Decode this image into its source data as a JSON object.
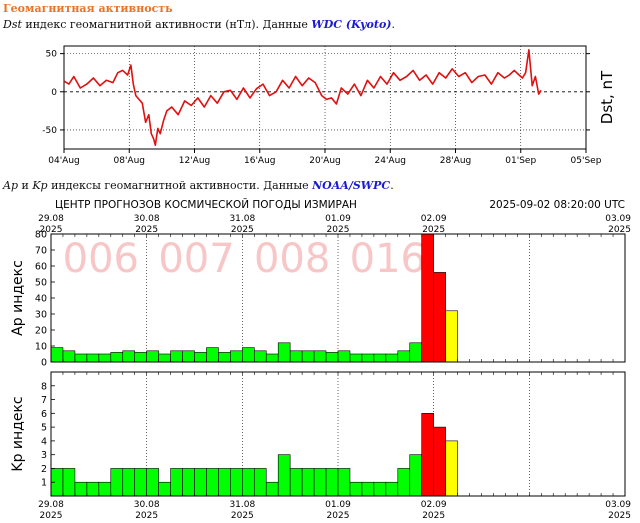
{
  "header": {
    "section_title": "Геомагнитная активность",
    "dst_caption_symbol": "Dst",
    "dst_caption_text": " индекс геомагнитной активности (нТл). Данные ",
    "dst_caption_source": "WDC (Kyoto)",
    "dst_caption_end": ".",
    "ap_caption_sym1": "Ap",
    "ap_caption_mid": " и ",
    "ap_caption_sym2": "Kp",
    "ap_caption_text": " индексы геомагнитной активности. Данные ",
    "ap_caption_source": "NOAA/SWPC",
    "ap_caption_end": "."
  },
  "chart_data": [
    {
      "type": "line",
      "ylabel": "Dst, nT",
      "ylim": [
        -75,
        60
      ],
      "y_ticks": [
        50,
        0,
        -50
      ],
      "x_ticks": [
        "04'Aug",
        "08'Aug",
        "12'Aug",
        "16'Aug",
        "20'Aug",
        "24'Aug",
        "28'Aug",
        "01'Sep",
        "05'Sep"
      ],
      "x_days": [
        0,
        4,
        8,
        12,
        16,
        20,
        24,
        28,
        32
      ],
      "grid": true,
      "color": "#e01010",
      "x": [
        0,
        0.3,
        0.6,
        1,
        1.4,
        1.8,
        2.2,
        2.6,
        3,
        3.3,
        3.6,
        3.9,
        4.1,
        4.25,
        4.4,
        4.6,
        4.8,
        5,
        5.2,
        5.35,
        5.5,
        5.6,
        5.75,
        5.9,
        6.1,
        6.3,
        6.6,
        7,
        7.4,
        7.8,
        8.2,
        8.6,
        9,
        9.4,
        9.8,
        10.2,
        10.6,
        11,
        11.4,
        11.8,
        12.2,
        12.6,
        13,
        13.4,
        13.8,
        14.2,
        14.6,
        15,
        15.4,
        15.8,
        16.1,
        16.4,
        16.7,
        17,
        17.4,
        17.8,
        18.2,
        18.6,
        19,
        19.4,
        19.8,
        20.2,
        20.6,
        21,
        21.4,
        21.8,
        22.2,
        22.6,
        23,
        23.4,
        23.8,
        24.2,
        24.6,
        25,
        25.4,
        25.8,
        26.2,
        26.6,
        27,
        27.3,
        27.6,
        27.9,
        28.1,
        28.3,
        28.5,
        28.7,
        28.9,
        29.1,
        29.25,
        29.4
      ],
      "values": [
        14,
        10,
        20,
        5,
        10,
        18,
        8,
        15,
        12,
        25,
        28,
        22,
        35,
        10,
        -5,
        -10,
        -15,
        -40,
        -30,
        -55,
        -62,
        -70,
        -48,
        -55,
        -38,
        -25,
        -20,
        -30,
        -12,
        -18,
        -8,
        -20,
        -5,
        -15,
        0,
        2,
        -10,
        5,
        -8,
        4,
        10,
        -5,
        0,
        15,
        5,
        20,
        8,
        18,
        12,
        -5,
        -10,
        -8,
        -16,
        5,
        -3,
        10,
        -5,
        15,
        5,
        20,
        10,
        25,
        15,
        20,
        28,
        15,
        22,
        10,
        25,
        18,
        30,
        20,
        25,
        12,
        20,
        22,
        10,
        25,
        18,
        22,
        28,
        22,
        18,
        25,
        55,
        8,
        20,
        -3,
        2
      ]
    },
    {
      "type": "bar",
      "title": "ЦЕНТР ПРОГНОЗОВ КОСМИЧЕСКОЙ ПОГОДЫ ИЗМИРАН",
      "timestamp": "2025-09-02 08:20:00 UTC",
      "ylabel": "Ap индекс",
      "ylim": [
        0,
        80
      ],
      "y_ticks": [
        0,
        10,
        20,
        30,
        40,
        50,
        60,
        70,
        80
      ],
      "watermark": [
        "006",
        "007",
        "008",
        "016"
      ],
      "date_labels": [
        {
          "date": "29.08",
          "year": "2025"
        },
        {
          "date": "30.08",
          "year": "2025"
        },
        {
          "date": "31.08",
          "year": "2025"
        },
        {
          "date": "01.09",
          "year": "2025"
        },
        {
          "date": "02.09",
          "year": "2025"
        },
        {
          "date": "03.09",
          "year": "2025"
        }
      ],
      "values": [
        9,
        7,
        5,
        5,
        5,
        6,
        7,
        6,
        7,
        5,
        7,
        7,
        6,
        9,
        6,
        7,
        9,
        7,
        5,
        12,
        7,
        7,
        7,
        6,
        7,
        5,
        5,
        5,
        5,
        7,
        12,
        80,
        56,
        32
      ],
      "colors": [
        "#00ff00",
        "#00ff00",
        "#00ff00",
        "#00ff00",
        "#00ff00",
        "#00ff00",
        "#00ff00",
        "#00ff00",
        "#00ff00",
        "#00ff00",
        "#00ff00",
        "#00ff00",
        "#00ff00",
        "#00ff00",
        "#00ff00",
        "#00ff00",
        "#00ff00",
        "#00ff00",
        "#00ff00",
        "#00ff00",
        "#00ff00",
        "#00ff00",
        "#00ff00",
        "#00ff00",
        "#00ff00",
        "#00ff00",
        "#00ff00",
        "#00ff00",
        "#00ff00",
        "#00ff00",
        "#00ff00",
        "#ff0000",
        "#ff0000",
        "#ffff00"
      ]
    },
    {
      "type": "bar",
      "ylabel": "Kp индекс",
      "ylim": [
        0,
        9
      ],
      "y_ticks": [
        1,
        2,
        3,
        4,
        5,
        6,
        7,
        8
      ],
      "date_labels": [
        {
          "date": "29.08",
          "year": "2025"
        },
        {
          "date": "30.08",
          "year": "2025"
        },
        {
          "date": "31.08",
          "year": "2025"
        },
        {
          "date": "01.09",
          "year": "2025"
        },
        {
          "date": "02.09",
          "year": "2025"
        },
        {
          "date": "03.09",
          "year": "2025"
        }
      ],
      "values": [
        2,
        2,
        1,
        1,
        1,
        2,
        2,
        2,
        2,
        1,
        2,
        2,
        2,
        2,
        2,
        2,
        2,
        2,
        1,
        3,
        2,
        2,
        2,
        2,
        2,
        1,
        1,
        1,
        1,
        2,
        3,
        6,
        5,
        4
      ],
      "colors": [
        "#00ff00",
        "#00ff00",
        "#00ff00",
        "#00ff00",
        "#00ff00",
        "#00ff00",
        "#00ff00",
        "#00ff00",
        "#00ff00",
        "#00ff00",
        "#00ff00",
        "#00ff00",
        "#00ff00",
        "#00ff00",
        "#00ff00",
        "#00ff00",
        "#00ff00",
        "#00ff00",
        "#00ff00",
        "#00ff00",
        "#00ff00",
        "#00ff00",
        "#00ff00",
        "#00ff00",
        "#00ff00",
        "#00ff00",
        "#00ff00",
        "#00ff00",
        "#00ff00",
        "#00ff00",
        "#00ff00",
        "#ff0000",
        "#ff0000",
        "#ffff00"
      ]
    }
  ]
}
